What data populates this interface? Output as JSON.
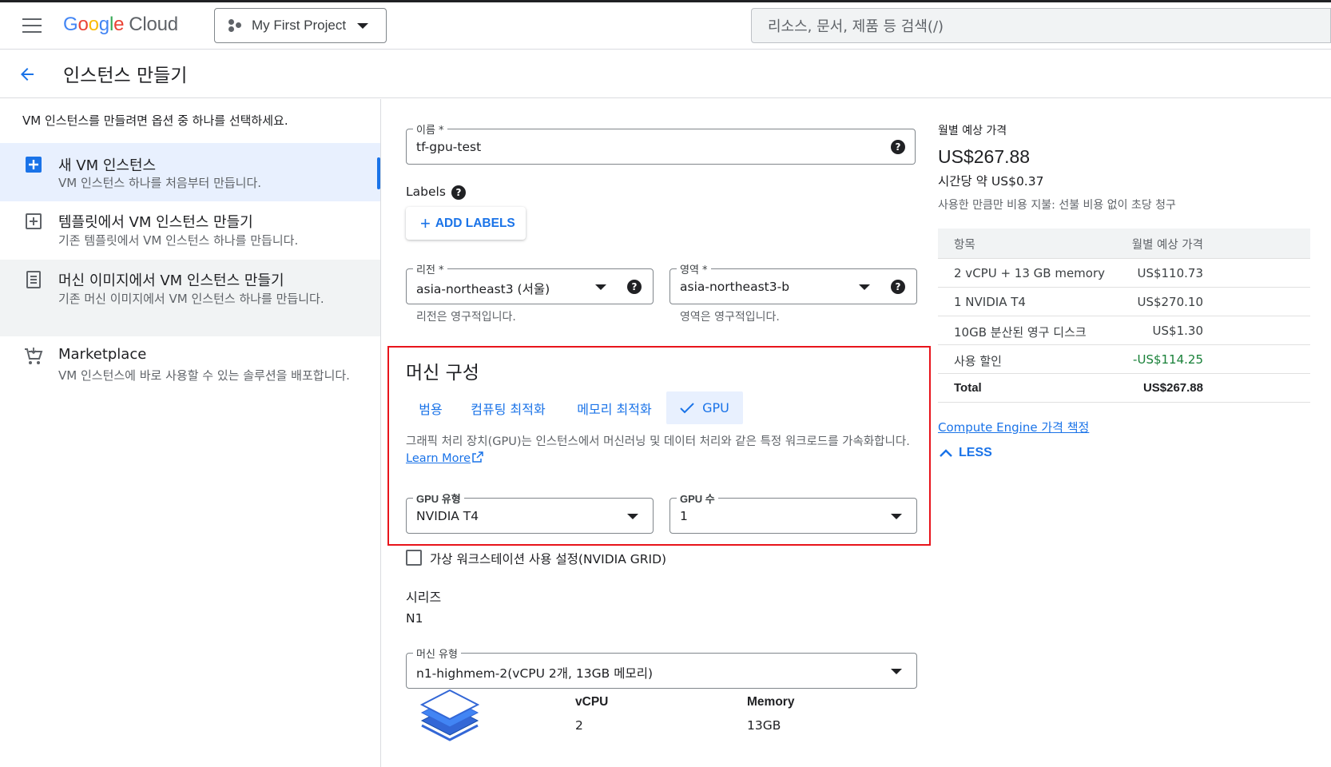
{
  "header": {
    "logo_google": "Google",
    "logo_cloud": "Cloud",
    "project": "My First Project",
    "search_placeholder": "리소스, 문서, 제품 등 검색(/)"
  },
  "page": {
    "title": "인스턴스 만들기"
  },
  "leftnav": {
    "intro": "VM 인스턴스를 만들려면 옵션 중 하나를 선택하세요.",
    "items": [
      {
        "title": "새 VM 인스턴스",
        "desc": "VM 인스턴스 하나를 처음부터 만듭니다.",
        "icon": "add-box-icon"
      },
      {
        "title": "템플릿에서 VM 인스턴스 만들기",
        "desc": "기존 템플릿에서 VM 인스턴스 하나를 만듭니다.",
        "icon": "template-add-icon"
      },
      {
        "title": "머신 이미지에서 VM 인스턴스 만들기",
        "desc": "기존 머신 이미지에서 VM 인스턴스 하나를 만듭니다.",
        "icon": "machine-image-icon"
      },
      {
        "title": "Marketplace",
        "desc": "VM 인스턴스에 바로 사용할 수 있는 솔루션을 배포합니다.",
        "icon": "cart-icon"
      }
    ]
  },
  "form": {
    "name_label": "이름 *",
    "name_value": "tf-gpu-test",
    "labels_title": "Labels",
    "add_labels": "ADD LABELS",
    "region_label": "리전 *",
    "region_value": "asia-northeast3 (서울)",
    "region_hint": "리전은 영구적입니다.",
    "zone_label": "영역 *",
    "zone_value": "asia-northeast3-b",
    "zone_hint": "영역은 영구적입니다.",
    "machine_config_title": "머신 구성",
    "tabs": [
      "범용",
      "컴퓨팅 최적화",
      "메모리 최적화",
      "GPU"
    ],
    "gpu_desc": "그래픽 처리 장치(GPU)는 인스턴스에서 머신러닝 및 데이터 처리와 같은 특정 워크로드를 가속화합니다.",
    "learn_more": "Learn More",
    "gpu_type_label": "GPU 유형",
    "gpu_type_value": "NVIDIA T4",
    "gpu_count_label": "GPU 수",
    "gpu_count_value": "1",
    "virtual_ws_label": "가상 워크스테이션 사용 설정(NVIDIA GRID)",
    "series_title": "시리즈",
    "series_value": "N1",
    "machine_type_label": "머신 유형",
    "machine_type_value": "n1-highmem-2(vCPU 2개, 13GB 메모리)",
    "vcpu_label": "vCPU",
    "vcpu_value": "2",
    "memory_label": "Memory",
    "memory_value": "13GB"
  },
  "pricing": {
    "label": "월별 예상 가격",
    "total": "US$267.88",
    "hourly": "시간당 약 US$0.37",
    "note": "사용한 만큼만 비용 지불: 선불 비용 없이 초당 청구",
    "col_item": "항목",
    "col_price": "월별 예상 가격",
    "rows": [
      {
        "item": "2 vCPU + 13 GB memory",
        "price": "US$110.73"
      },
      {
        "item": "1 NVIDIA T4",
        "price": "US$270.10"
      },
      {
        "item": "10GB 분산된 영구 디스크",
        "price": "US$1.30"
      },
      {
        "item": "사용 할인",
        "price": "-US$114.25"
      },
      {
        "item": "Total",
        "price": "US$267.88"
      }
    ],
    "link": "Compute Engine 가격 책정",
    "less": "LESS",
    "discount_color": "#188038"
  }
}
